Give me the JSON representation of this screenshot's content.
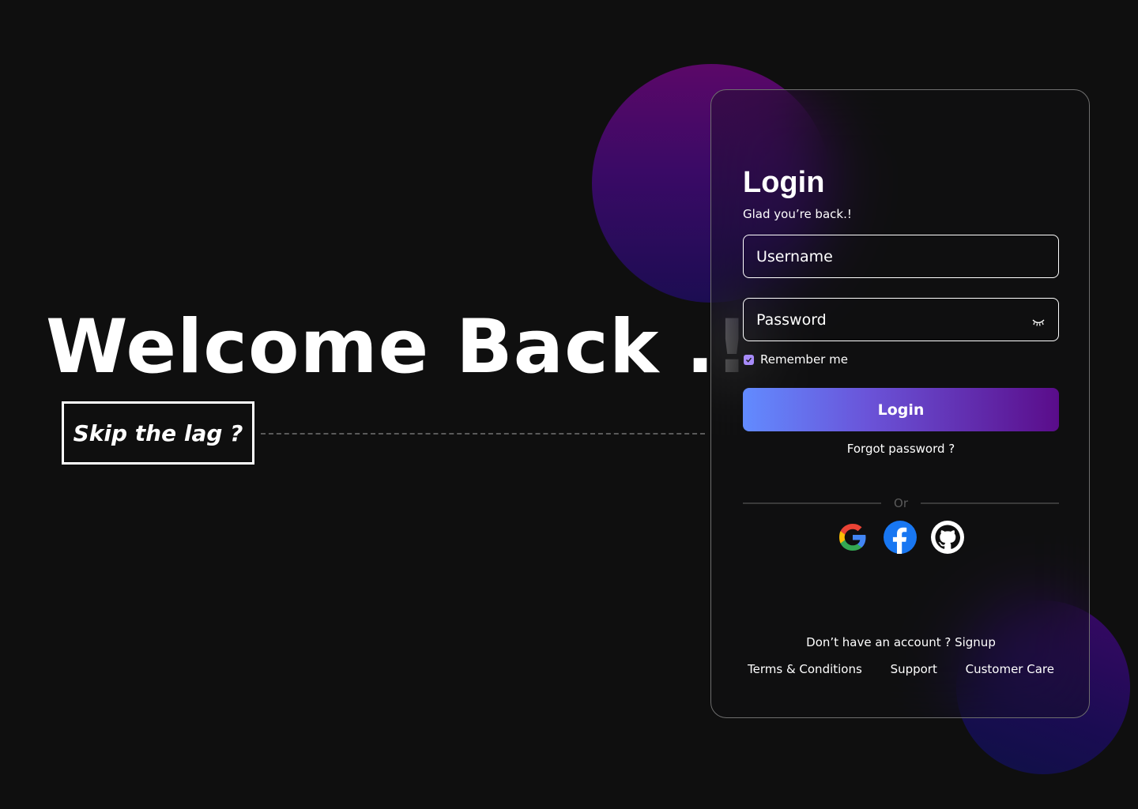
{
  "hero": {
    "title": "Welcome Back .!",
    "tagline": "Skip the lag ?"
  },
  "login": {
    "title": "Login",
    "subtitle": "Glad you’re back.!",
    "username_placeholder": "Username",
    "password_placeholder": "Password",
    "remember_label": "Remember me",
    "remember_checked": true,
    "button_label": "Login",
    "forgot_label": "Forgot password ?",
    "divider_label": "Or",
    "social_icons": [
      "google-icon",
      "facebook-icon",
      "github-icon"
    ],
    "signup_prompt": "Don’t have an account ? ",
    "signup_label": "Signup"
  },
  "footer": {
    "links": [
      "Terms & Conditions",
      "Support",
      "Customer Care"
    ]
  },
  "colors": {
    "background": "#0f0f0f",
    "accent_start": "#628bff",
    "accent_end": "#5a0c8a",
    "checkbox": "#a78bfa"
  }
}
